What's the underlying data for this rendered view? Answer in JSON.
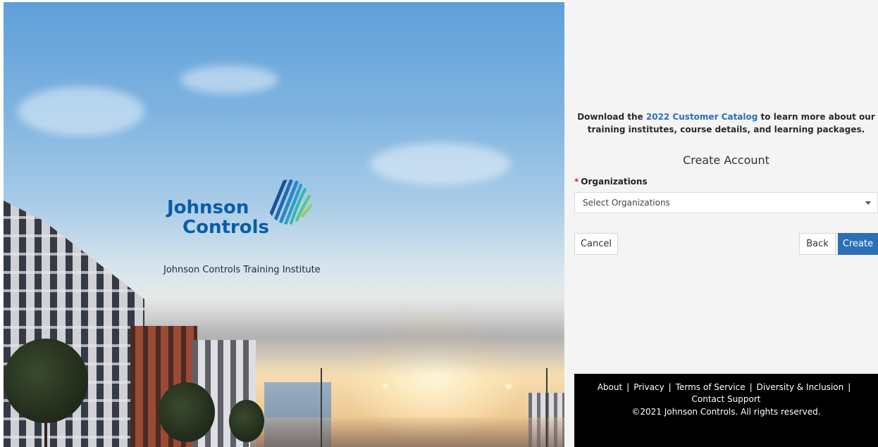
{
  "hero": {
    "logo_line1": "Johnson",
    "logo_line2": "Controls",
    "subtitle": "Johnson Controls Training Institute"
  },
  "promo": {
    "prefix": "Download the ",
    "link_text": "2022 Customer Catalog",
    "suffix": " to learn more about our training institutes, course details, and learning packages."
  },
  "form": {
    "title": "Create Account",
    "required_marker": "*",
    "org_label": "Organizations",
    "org_placeholder": "Select Organizations"
  },
  "buttons": {
    "cancel": "Cancel",
    "back": "Back",
    "create": "Create"
  },
  "footer": {
    "links": {
      "about": "About",
      "privacy": "Privacy",
      "terms": "Terms of Service",
      "diversity": "Diversity & Inclusion",
      "support": "Contact Support"
    },
    "separator": "|",
    "copyright": "©2021 Johnson Controls. All rights reserved."
  },
  "colors": {
    "brand_blue": "#0a5cab",
    "link_blue": "#2a6fb8",
    "primary_button": "#2a6fb8",
    "required_red": "#d32f2f",
    "panel_bg": "#f4f4f4",
    "footer_bg": "#000000"
  },
  "icons": {
    "logo_mark": "johnson-controls-logo-mark",
    "select_caret": "caret-down-icon"
  }
}
